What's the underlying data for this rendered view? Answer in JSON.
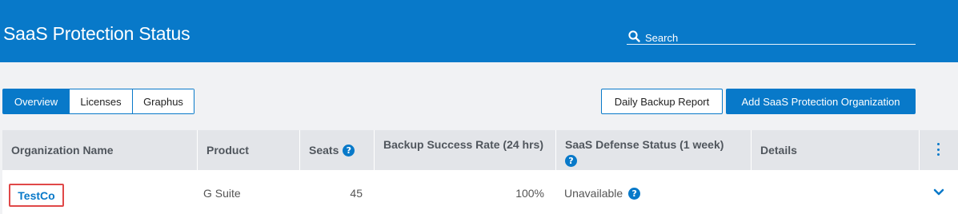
{
  "header": {
    "title": "SaaS Protection Status",
    "search": {
      "placeholder": "Search",
      "value": ""
    }
  },
  "tabs": [
    {
      "label": "Overview",
      "active": true
    },
    {
      "label": "Licenses",
      "active": false
    },
    {
      "label": "Graphus",
      "active": false
    }
  ],
  "actions": {
    "report_label": "Daily Backup Report",
    "add_label": "Add SaaS Protection Organization"
  },
  "table": {
    "columns": [
      {
        "label": "Organization Name",
        "help": false
      },
      {
        "label": "Product",
        "help": false
      },
      {
        "label": "Seats",
        "help": true
      },
      {
        "label": "Backup Success Rate (24 hrs)",
        "help": false
      },
      {
        "label": "SaaS Defense Status (1 week)",
        "help": true
      },
      {
        "label": "Details",
        "help": false
      }
    ],
    "rows": [
      {
        "org": "TestCo",
        "product": "G Suite",
        "seats": "45",
        "backup_rate": "100%",
        "defense_status": "Unavailable",
        "details": ""
      }
    ]
  },
  "icons": {
    "search": "search-icon",
    "help": "help-circle-icon",
    "help_glyph": "?",
    "more": "more-vertical-icon",
    "expand": "chevron-down-icon"
  },
  "colors": {
    "brand": "#0879c9",
    "header_bg": "#0879c9",
    "table_header_bg": "#e3e5e9",
    "page_bg": "#f1f2f4",
    "highlight": "#e04848"
  }
}
